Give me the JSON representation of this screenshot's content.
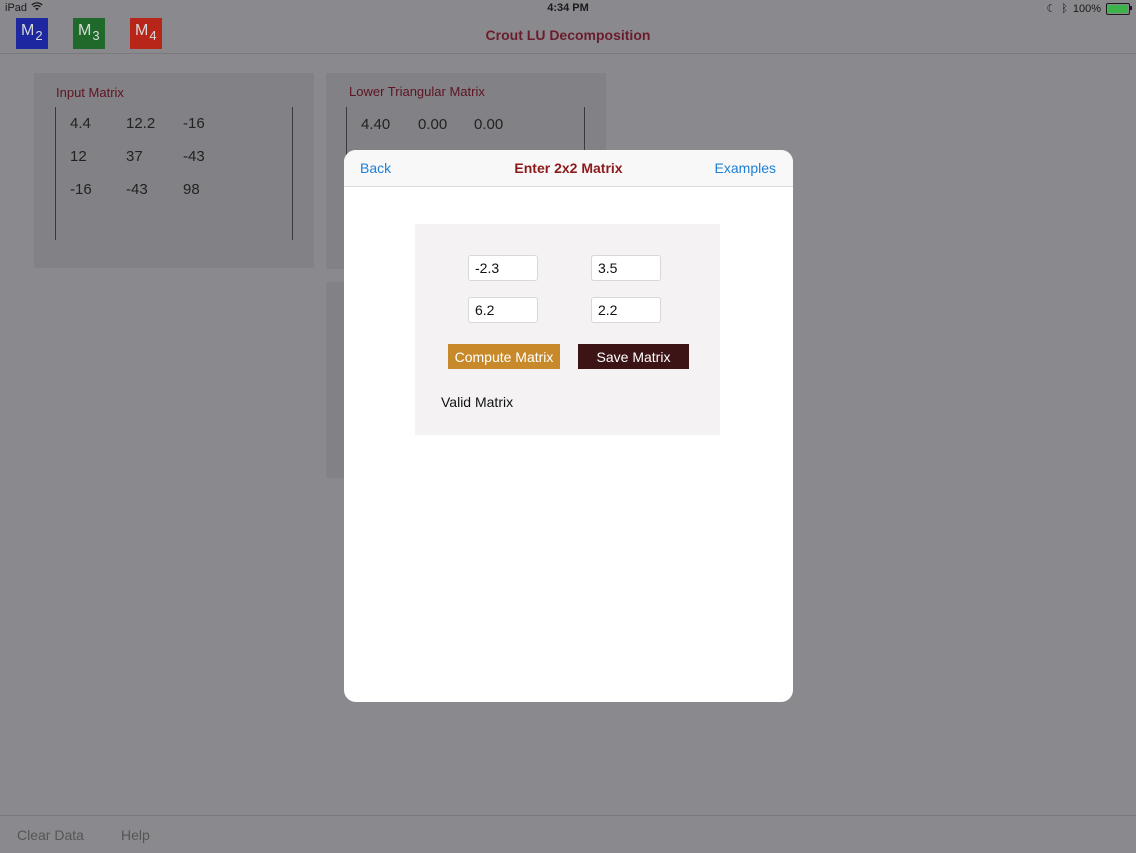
{
  "status": {
    "device": "iPad",
    "time": "4:34 PM",
    "battery": "100%"
  },
  "nav": {
    "title": "Crout LU Decomposition",
    "buttons": [
      {
        "letter": "M",
        "sub": "2",
        "color": "#1c27a0"
      },
      {
        "letter": "M",
        "sub": "3",
        "color": "#1f6a2a"
      },
      {
        "letter": "M",
        "sub": "4",
        "color": "#b8261a"
      }
    ]
  },
  "input_matrix": {
    "title": "Input Matrix",
    "rows": [
      [
        "4.4",
        "12.2",
        "-16"
      ],
      [
        "12",
        "37",
        "-43"
      ],
      [
        "-16",
        "-43",
        "98"
      ]
    ]
  },
  "lower_matrix": {
    "title": "Lower Triangular Matrix",
    "rows": [
      [
        "4.40",
        "0.00",
        "0.00"
      ]
    ]
  },
  "modal": {
    "back": "Back",
    "title": "Enter 2x2 Matrix",
    "examples": "Examples",
    "cells": [
      [
        "-2.3",
        "3.5"
      ],
      [
        "6.2",
        "2.2"
      ]
    ],
    "compute_label": "Compute Matrix",
    "save_label": "Save Matrix",
    "status": "Valid Matrix"
  },
  "bottom": {
    "clear": "Clear Data",
    "help": "Help"
  }
}
